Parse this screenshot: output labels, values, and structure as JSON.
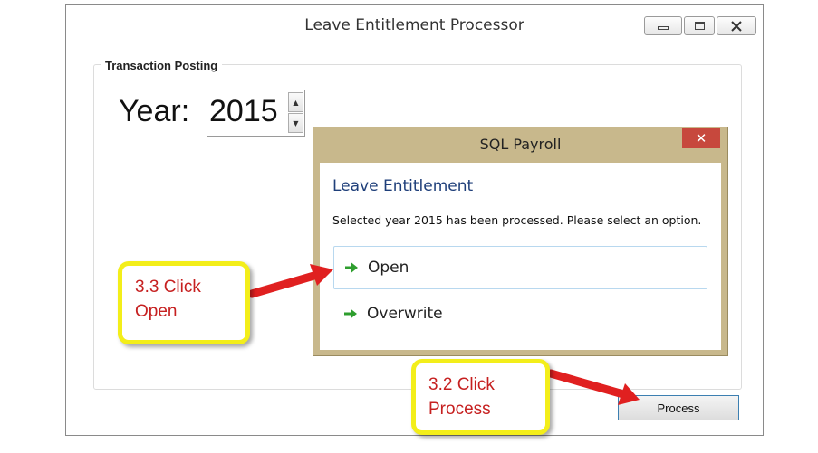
{
  "window": {
    "title": "Leave Entitlement Processor",
    "app_icon": "app-logo-icon"
  },
  "form": {
    "group_label": "Transaction Posting",
    "year_label": "Year:",
    "year_value": "2015",
    "process_button": "Process"
  },
  "dialog": {
    "title": "SQL Payroll",
    "close_glyph": "✕",
    "heading": "Leave Entitlement",
    "message": "Selected year 2015 has been processed. Please select an option.",
    "options": [
      {
        "label": "Open",
        "icon": "green-arrow-icon"
      },
      {
        "label": "Overwrite",
        "icon": "green-arrow-icon"
      }
    ]
  },
  "callouts": [
    {
      "line1": "3.3 Click",
      "line2": "Open"
    },
    {
      "line1": "3.2 Click",
      "line2": "Process"
    }
  ],
  "colors": {
    "dialog_frame": "#c8b88c",
    "heading_blue": "#1f3f7a",
    "close_red": "#c7483d",
    "callout_border": "#f3ee1a",
    "callout_text": "#c62020",
    "arrow_red": "#e02020"
  }
}
